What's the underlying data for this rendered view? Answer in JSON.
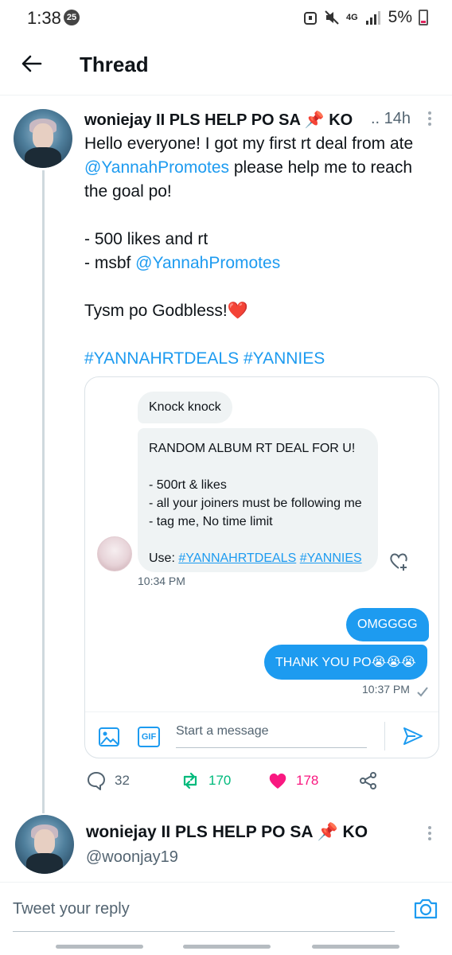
{
  "status_bar": {
    "time": "1:38",
    "notification_count": "25",
    "network": "4G",
    "battery": "5%"
  },
  "header": {
    "title": "Thread"
  },
  "tweet": {
    "author_name": "woniejay II PLS HELP PO SA 📌 KO",
    "time": ".. 14h",
    "lines": {
      "l1": "Hello everyone! I got my first rt deal from ate",
      "l2_link": "@YannahPromotes",
      "l2_rest": " please help me to reach",
      "l3": "the goal po!",
      "l4": "- 500 likes and rt",
      "l5_prefix": "- msbf ",
      "l5_link": "@YannahPromotes",
      "l6": "Tysm po Godbless!❤️",
      "hashtags": "#YANNAHRTDEALS #YANNIES"
    },
    "dm": {
      "msg1": "Knock knock",
      "msg2": {
        "title": "RANDOM ALBUM RT DEAL FOR U!",
        "line1": "- 500rt & likes",
        "line2": "- all your joiners must be following me",
        "line3": "- tag me, No time limit",
        "use_label": "Use: ",
        "tag1": "#YANNAHRTDEALS",
        "tag2": "#YANNIES"
      },
      "received_time": "10:34 PM",
      "out1": "OMGGGG",
      "out2": "THANK YOU PO😭😭😭",
      "sent_time": "10:37 PM",
      "composer_placeholder": "Start a message",
      "gif_label": "GIF"
    },
    "actions": {
      "replies": "32",
      "retweets": "170",
      "likes": "178"
    }
  },
  "author_row": {
    "name": "woniejay II PLS HELP PO SA 📌 KO",
    "handle": "@woonjay19"
  },
  "reply_bar": {
    "placeholder": "Tweet your reply"
  },
  "colors": {
    "accent": "#1d9bf0",
    "retweet": "#00ba7c",
    "like": "#f91880"
  }
}
